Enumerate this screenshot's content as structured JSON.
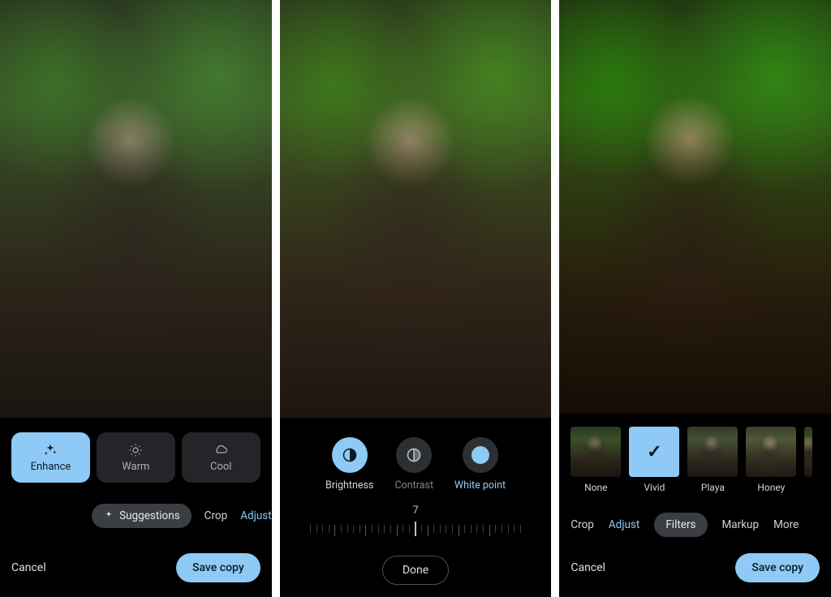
{
  "screen1": {
    "suggestions": [
      {
        "id": "enhance",
        "label": "Enhance",
        "icon": "sparkle",
        "active": true
      },
      {
        "id": "warm",
        "label": "Warm",
        "icon": "sun",
        "active": false
      },
      {
        "id": "cool",
        "label": "Cool",
        "icon": "cloud",
        "active": false
      }
    ],
    "tabs": {
      "suggestions_label": "Suggestions",
      "crop_label": "Crop",
      "adjust_label": "Adjust"
    },
    "footer": {
      "cancel": "Cancel",
      "save": "Save copy"
    }
  },
  "screen2": {
    "adjustments": [
      {
        "id": "brightness",
        "label": "Brightness",
        "active": true
      },
      {
        "id": "contrast",
        "label": "Contrast",
        "active": false
      },
      {
        "id": "whitepoint",
        "label": "White point",
        "active": false,
        "highlight": true
      }
    ],
    "slider_value": "7",
    "done_label": "Done"
  },
  "screen3": {
    "filters": [
      {
        "id": "none",
        "label": "None",
        "selected": false
      },
      {
        "id": "vivid",
        "label": "Vivid",
        "selected": true
      },
      {
        "id": "playa",
        "label": "Playa",
        "selected": false
      },
      {
        "id": "honey",
        "label": "Honey",
        "selected": false
      }
    ],
    "tabs": {
      "crop": "Crop",
      "adjust": "Adjust",
      "filters": "Filters",
      "markup": "Markup",
      "more": "More"
    },
    "footer": {
      "cancel": "Cancel",
      "save": "Save copy"
    }
  },
  "colors": {
    "accent": "#8ecaf5",
    "chip_bg": "#232528",
    "pill_bg": "#3a3d42"
  }
}
